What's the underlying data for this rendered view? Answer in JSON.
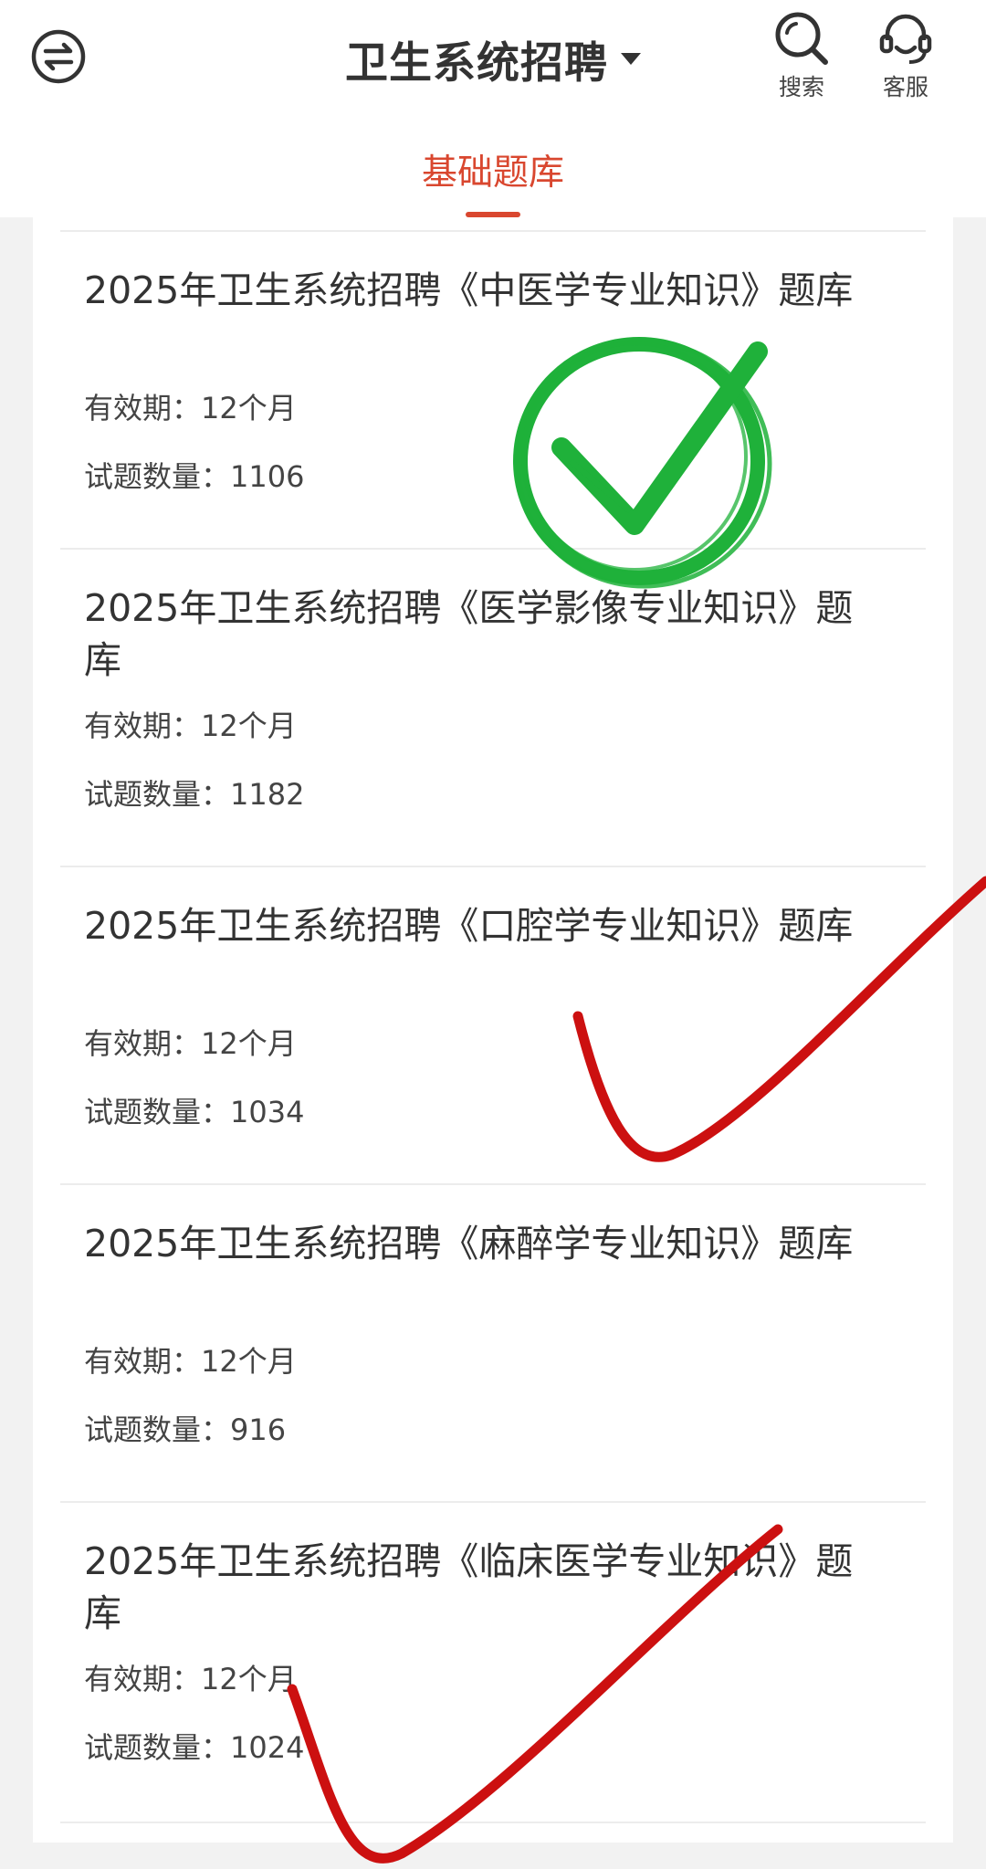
{
  "header": {
    "title": "卫生系统招聘",
    "switch_icon": "swap-arrows-icon",
    "actions": [
      {
        "label": "搜索",
        "icon": "search-icon"
      },
      {
        "label": "客服",
        "icon": "headset-icon"
      }
    ]
  },
  "tabs": [
    {
      "label": "基础题库",
      "active": true
    }
  ],
  "items": [
    {
      "title": "2025年卫生系统招聘《中医学专业知识》题库",
      "valid": "有效期：12个月",
      "count": "试题数量：1106"
    },
    {
      "title": "2025年卫生系统招聘《医学影像专业知识》题库",
      "valid": "有效期：12个月",
      "count": "试题数量：1182"
    },
    {
      "title": "2025年卫生系统招聘《口腔学专业知识》题库",
      "valid": "有效期：12个月",
      "count": "试题数量：1034"
    },
    {
      "title": "2025年卫生系统招聘《麻醉学专业知识》题库",
      "valid": "有效期：12个月",
      "count": "试题数量：916"
    },
    {
      "title": "2025年卫生系统招聘《临床医学专业知识》题库",
      "valid": "有效期：12个月",
      "count": "试题数量：1024"
    }
  ],
  "colors": {
    "accent": "#d9472f",
    "green_check": "#1fb13a",
    "red_check": "#cc1010"
  }
}
